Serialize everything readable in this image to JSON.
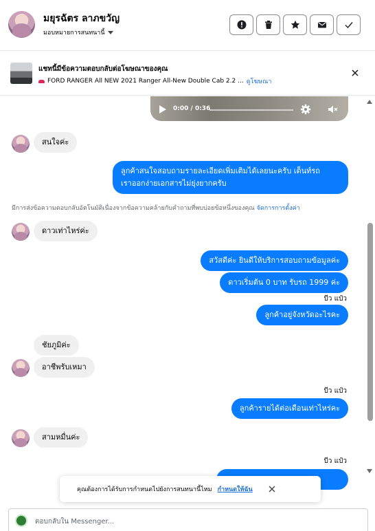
{
  "header": {
    "user_name": "มยุรฉัตร ลาภขวัญ",
    "assign_label": "มอบหมายการสนทนานี้",
    "actions": [
      "spam-icon",
      "trash-icon",
      "star-icon",
      "envelope-icon",
      "check-icon"
    ]
  },
  "ad": {
    "title": "แชทนี้มีข้อความตอบกลับต่อโฆษณาของคุณ",
    "subtitle": "FORD RANGER All NEW 2021 Ranger All-New Double Cab 2.2 ...",
    "link": "ดูโฆษณา"
  },
  "video": {
    "time": "0:00 / 0:36",
    "progress": 0
  },
  "messages": {
    "m1": "สนใจค่ะ",
    "m2_line1": "ลูกค้าสนใจสอบถามรายละเอียดเพิ่มเติมได้เลยนะครับ เต็นท์รถ",
    "m2_line2": "เราออกง่ายเอกสารไม่ยุ่งยากครับ",
    "notice": "มีการส่งข้อความตอบกลับอัตโนมัติเนื่องจากข้อความคล้ายกับคำถามที่พบบ่อยข้อหนึ่งของคุณ",
    "notice_link": "จัดการการตั้งค่า",
    "m3": "ดาวเท่าไหร่ค่ะ",
    "m4": "สวัสดีค่ะ  ยินดีให้บริการสอบถามข้อมูลค่ะ",
    "m5": "ดาวเริ่มต้น 0 บาท รับรถ 1999 ค่ะ",
    "seen1": "บีว แป๋ว",
    "m6": "ลูกค้าอยู่จังหวัดอะไรคะ",
    "m7": "ชัยภูมิค่ะ",
    "m8": "อาชีพรับเหมา",
    "seen2": "บีว แป๋ว",
    "m9": "ลูกค้ารายได้ต่อเดือนเท่าไหร่คะ",
    "m10": "สามหมื่นค่ะ",
    "seen3": "บีว แป๋ว"
  },
  "toast": {
    "text": "คุณต้องการได้รับการกำหนดไปยังการสนทนานี้ไหม",
    "action": "กำหนดให้ฉัน"
  },
  "composer": {
    "placeholder": "ตอบกลับใน Messenger..."
  },
  "colors": {
    "outgoing": "#0a7cff",
    "incoming": "#f0f0f0",
    "link": "#1a6fd8"
  }
}
